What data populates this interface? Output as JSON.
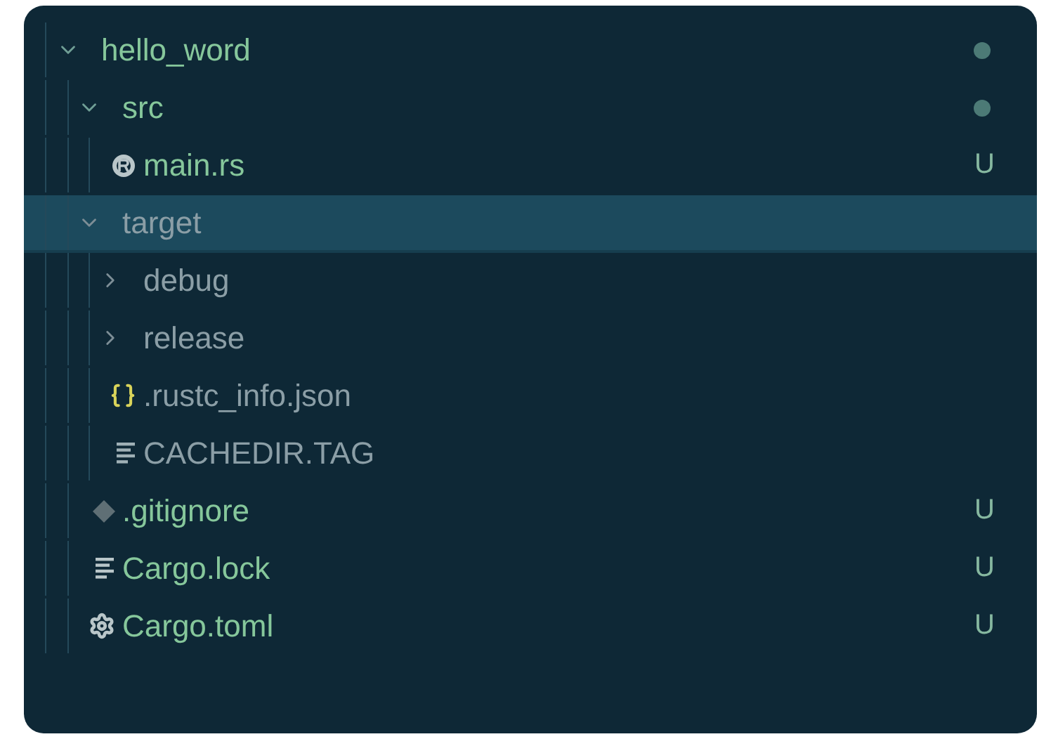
{
  "explorer": {
    "items": [
      {
        "name": "hello_word",
        "kind": "folder",
        "expanded": true,
        "selected": false,
        "ignored": false,
        "dot": true,
        "children": [
          {
            "name": "src",
            "kind": "folder",
            "expanded": true,
            "selected": false,
            "ignored": false,
            "dot": true,
            "children": [
              {
                "name": "main.rs",
                "kind": "rust_file",
                "selected": false,
                "ignored": false,
                "status": "U"
              }
            ]
          },
          {
            "name": "target",
            "kind": "folder",
            "expanded": true,
            "selected": true,
            "ignored": true,
            "dot": false,
            "children": [
              {
                "name": "debug",
                "kind": "folder",
                "expanded": false,
                "selected": false,
                "ignored": true,
                "dot": false
              },
              {
                "name": "release",
                "kind": "folder",
                "expanded": false,
                "selected": false,
                "ignored": true,
                "dot": false
              },
              {
                "name": ".rustc_info.json",
                "kind": "json_file",
                "selected": false,
                "ignored": true
              },
              {
                "name": "CACHEDIR.TAG",
                "kind": "text_file",
                "selected": false,
                "ignored": true
              }
            ]
          },
          {
            "name": ".gitignore",
            "kind": "ignore_file",
            "selected": false,
            "ignored": false,
            "status": "U"
          },
          {
            "name": "Cargo.lock",
            "kind": "text_file",
            "selected": false,
            "ignored": false,
            "status": "U"
          },
          {
            "name": "Cargo.toml",
            "kind": "config_file",
            "selected": false,
            "ignored": false,
            "status": "U"
          }
        ]
      }
    ]
  }
}
